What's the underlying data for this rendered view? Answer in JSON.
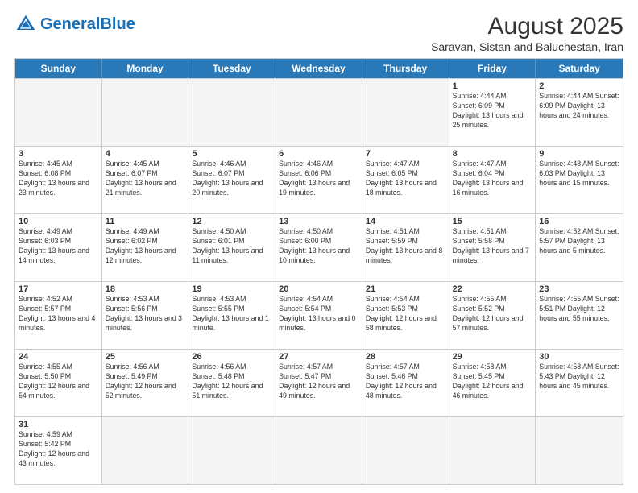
{
  "header": {
    "logo_general": "General",
    "logo_blue": "Blue",
    "month_year": "August 2025",
    "location": "Saravan, Sistan and Baluchestan, Iran"
  },
  "weekdays": [
    "Sunday",
    "Monday",
    "Tuesday",
    "Wednesday",
    "Thursday",
    "Friday",
    "Saturday"
  ],
  "rows": [
    [
      {
        "day": "",
        "empty": true
      },
      {
        "day": "",
        "empty": true
      },
      {
        "day": "",
        "empty": true
      },
      {
        "day": "",
        "empty": true
      },
      {
        "day": "",
        "empty": true
      },
      {
        "day": "1",
        "info": "Sunrise: 4:44 AM\nSunset: 6:09 PM\nDaylight: 13 hours\nand 25 minutes."
      },
      {
        "day": "2",
        "info": "Sunrise: 4:44 AM\nSunset: 6:09 PM\nDaylight: 13 hours\nand 24 minutes."
      }
    ],
    [
      {
        "day": "3",
        "info": "Sunrise: 4:45 AM\nSunset: 6:08 PM\nDaylight: 13 hours\nand 23 minutes."
      },
      {
        "day": "4",
        "info": "Sunrise: 4:45 AM\nSunset: 6:07 PM\nDaylight: 13 hours\nand 21 minutes."
      },
      {
        "day": "5",
        "info": "Sunrise: 4:46 AM\nSunset: 6:07 PM\nDaylight: 13 hours\nand 20 minutes."
      },
      {
        "day": "6",
        "info": "Sunrise: 4:46 AM\nSunset: 6:06 PM\nDaylight: 13 hours\nand 19 minutes."
      },
      {
        "day": "7",
        "info": "Sunrise: 4:47 AM\nSunset: 6:05 PM\nDaylight: 13 hours\nand 18 minutes."
      },
      {
        "day": "8",
        "info": "Sunrise: 4:47 AM\nSunset: 6:04 PM\nDaylight: 13 hours\nand 16 minutes."
      },
      {
        "day": "9",
        "info": "Sunrise: 4:48 AM\nSunset: 6:03 PM\nDaylight: 13 hours\nand 15 minutes."
      }
    ],
    [
      {
        "day": "10",
        "info": "Sunrise: 4:49 AM\nSunset: 6:03 PM\nDaylight: 13 hours\nand 14 minutes."
      },
      {
        "day": "11",
        "info": "Sunrise: 4:49 AM\nSunset: 6:02 PM\nDaylight: 13 hours\nand 12 minutes."
      },
      {
        "day": "12",
        "info": "Sunrise: 4:50 AM\nSunset: 6:01 PM\nDaylight: 13 hours\nand 11 minutes."
      },
      {
        "day": "13",
        "info": "Sunrise: 4:50 AM\nSunset: 6:00 PM\nDaylight: 13 hours\nand 10 minutes."
      },
      {
        "day": "14",
        "info": "Sunrise: 4:51 AM\nSunset: 5:59 PM\nDaylight: 13 hours\nand 8 minutes."
      },
      {
        "day": "15",
        "info": "Sunrise: 4:51 AM\nSunset: 5:58 PM\nDaylight: 13 hours\nand 7 minutes."
      },
      {
        "day": "16",
        "info": "Sunrise: 4:52 AM\nSunset: 5:57 PM\nDaylight: 13 hours\nand 5 minutes."
      }
    ],
    [
      {
        "day": "17",
        "info": "Sunrise: 4:52 AM\nSunset: 5:57 PM\nDaylight: 13 hours\nand 4 minutes."
      },
      {
        "day": "18",
        "info": "Sunrise: 4:53 AM\nSunset: 5:56 PM\nDaylight: 13 hours\nand 3 minutes."
      },
      {
        "day": "19",
        "info": "Sunrise: 4:53 AM\nSunset: 5:55 PM\nDaylight: 13 hours\nand 1 minute."
      },
      {
        "day": "20",
        "info": "Sunrise: 4:54 AM\nSunset: 5:54 PM\nDaylight: 13 hours\nand 0 minutes."
      },
      {
        "day": "21",
        "info": "Sunrise: 4:54 AM\nSunset: 5:53 PM\nDaylight: 12 hours\nand 58 minutes."
      },
      {
        "day": "22",
        "info": "Sunrise: 4:55 AM\nSunset: 5:52 PM\nDaylight: 12 hours\nand 57 minutes."
      },
      {
        "day": "23",
        "info": "Sunrise: 4:55 AM\nSunset: 5:51 PM\nDaylight: 12 hours\nand 55 minutes."
      }
    ],
    [
      {
        "day": "24",
        "info": "Sunrise: 4:55 AM\nSunset: 5:50 PM\nDaylight: 12 hours\nand 54 minutes."
      },
      {
        "day": "25",
        "info": "Sunrise: 4:56 AM\nSunset: 5:49 PM\nDaylight: 12 hours\nand 52 minutes."
      },
      {
        "day": "26",
        "info": "Sunrise: 4:56 AM\nSunset: 5:48 PM\nDaylight: 12 hours\nand 51 minutes."
      },
      {
        "day": "27",
        "info": "Sunrise: 4:57 AM\nSunset: 5:47 PM\nDaylight: 12 hours\nand 49 minutes."
      },
      {
        "day": "28",
        "info": "Sunrise: 4:57 AM\nSunset: 5:46 PM\nDaylight: 12 hours\nand 48 minutes."
      },
      {
        "day": "29",
        "info": "Sunrise: 4:58 AM\nSunset: 5:45 PM\nDaylight: 12 hours\nand 46 minutes."
      },
      {
        "day": "30",
        "info": "Sunrise: 4:58 AM\nSunset: 5:43 PM\nDaylight: 12 hours\nand 45 minutes."
      }
    ],
    [
      {
        "day": "31",
        "info": "Sunrise: 4:59 AM\nSunset: 5:42 PM\nDaylight: 12 hours\nand 43 minutes."
      },
      {
        "day": "",
        "empty": true
      },
      {
        "day": "",
        "empty": true
      },
      {
        "day": "",
        "empty": true
      },
      {
        "day": "",
        "empty": true
      },
      {
        "day": "",
        "empty": true
      },
      {
        "day": "",
        "empty": true
      }
    ]
  ]
}
